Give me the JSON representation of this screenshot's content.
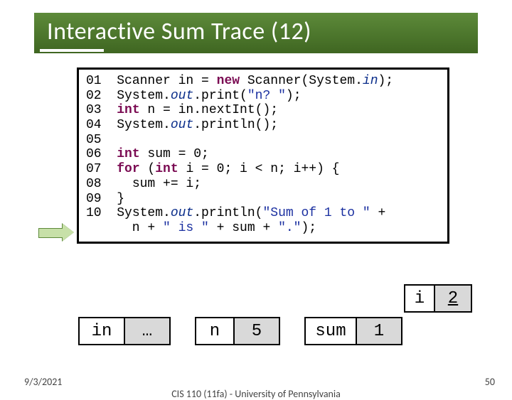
{
  "title": "Interactive Sum Trace (12)",
  "code": {
    "l01n": "01",
    "l01a": "Scanner in = ",
    "l01kw": "new",
    "l01b": " Scanner(System.",
    "l01st": "in",
    "l01c": ");",
    "l02n": "02",
    "l02a": "System.",
    "l02st": "out",
    "l02b": ".print(",
    "l02s": "\"n? \"",
    "l02c": ");",
    "l03n": "03",
    "l03kw": "int",
    "l03a": " n = in.nextInt();",
    "l04n": "04",
    "l04a": "System.",
    "l04st": "out",
    "l04b": ".println();",
    "l05n": "05",
    "l06n": "06",
    "l06kw": "int",
    "l06a": " sum = 0;",
    "l07n": "07",
    "l07kw1": "for",
    "l07a": " (",
    "l07kw2": "int",
    "l07b": " i = 0; i < n; i++) {",
    "l08n": "08",
    "l08a": "  sum += i;",
    "l09n": "09",
    "l09a": "}",
    "l10n": "10",
    "l10a": "System.",
    "l10st": "out",
    "l10b": ".println(",
    "l10s": "\"Sum of 1 to \"",
    "l10c": " +",
    "l11a": "      n + ",
    "l11s1": "\" is \"",
    "l11b": " + sum + ",
    "l11s2": "\".\"",
    "l11c": ");"
  },
  "trace": {
    "in_label": "in",
    "in_value": "…",
    "n_label": "n",
    "n_value": "5",
    "sum_label": "sum",
    "sum_value": "1",
    "i_label": "i",
    "i_value": "2"
  },
  "footer": {
    "date": "9/3/2021",
    "mid": "CIS 110 (11fa) - University of Pennsylvania",
    "page": "50"
  }
}
